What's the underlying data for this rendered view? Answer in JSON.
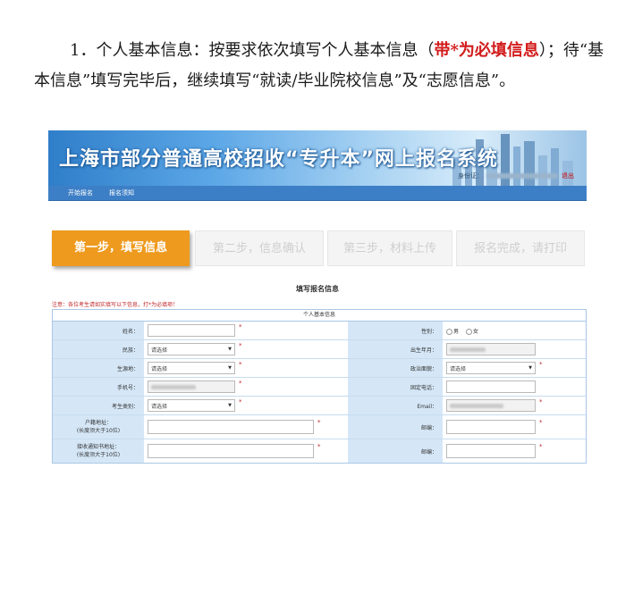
{
  "document": {
    "para_part1": "1．个人基本信息：按要求依次填写个人基本信息（",
    "para_red": "带*为必填信息",
    "para_part2": "）；待“基本信息”填写完毕后，继续填写“就读/毕业院校信息”及“志愿信息”。"
  },
  "site": {
    "banner_title": "上海市部分普通高校招收“专升本”网上报名系统",
    "user_label": "身份证：",
    "user_mark": "退出"
  },
  "nav": {
    "items": [
      "开始报名",
      "报名须知"
    ]
  },
  "steps": [
    {
      "label": "第一步，填写信息",
      "state": "active"
    },
    {
      "label": "第二步，信息确认",
      "state": "inactive"
    },
    {
      "label": "第三步，材料上传",
      "state": "inactive"
    },
    {
      "label": "报名完成，请打印",
      "state": "inactive"
    }
  ],
  "form": {
    "title": "填写报名信息",
    "notice": "注意：各位考生请如实填写以下信息，打*为必填项！",
    "section_header": "个人基本信息",
    "placeholder_select": "请选择",
    "fields": {
      "name": "姓名：",
      "gender": "性别：",
      "gender_options": [
        "男",
        "女"
      ],
      "ethnicity": "民族：",
      "birth": "出生年月：",
      "birthplace": "生源地：",
      "political": "政治面貌：",
      "mobile": "手机号：",
      "landline": "固定电话：",
      "category": "考生类别：",
      "email": "Email：",
      "hukou": "户籍地址：",
      "hukou_hint": "(长度须大于10位)",
      "postcode": "邮编：",
      "notice_addr": "接收通知书地址：",
      "notice_addr_hint": "(长度须大于10位)",
      "postcode2": "邮编："
    },
    "required_mark": "*"
  },
  "colors": {
    "accent_red": "#d21b1b",
    "step_active": "#ee9a1e",
    "label_bg": "#d5e7f7",
    "nav_blue": "#3d7fc6"
  }
}
